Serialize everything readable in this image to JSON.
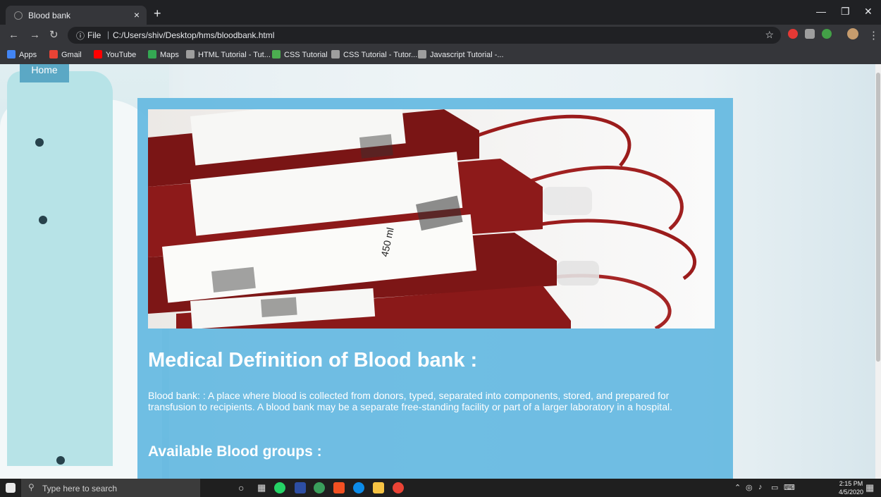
{
  "browser": {
    "tab_title": "Blood bank",
    "tab_close": "×",
    "new_tab": "+",
    "url_scheme": "File",
    "url_sep": "|",
    "url": "C:/Users/shiv/Desktop/hms/bloodbank.html"
  },
  "bookmarks": [
    {
      "label": "Apps",
      "color": "#4285f4"
    },
    {
      "label": "Gmail",
      "color": "#ea4335"
    },
    {
      "label": "YouTube",
      "color": "#ff0000"
    },
    {
      "label": "Maps",
      "color": "#34a853"
    },
    {
      "label": "HTML Tutorial - Tut...",
      "color": "#9e9e9e"
    },
    {
      "label": "CSS Tutorial",
      "color": "#4caf50"
    },
    {
      "label": "CSS Tutorial - Tutor...",
      "color": "#9e9e9e"
    },
    {
      "label": "Javascript Tutorial -...",
      "color": "#9e9e9e"
    }
  ],
  "page": {
    "nav_home": "Home",
    "heading": "Medical Definition of Blood bank :",
    "paragraph": "Blood bank: : A place where blood is collected from donors, typed, separated into components, stored, and prepared for transfusion to recipients. A blood bank may be a separate free-standing facility or part of a larger laboratory in a hospital.",
    "subheading": "Available Blood groups :",
    "card_color": "#64b9e1"
  },
  "photo_labels": {
    "volume": "450 ml"
  },
  "taskbar": {
    "search_placeholder": "Type here to search",
    "time": "2:15 PM",
    "date": "4/5/2020"
  }
}
